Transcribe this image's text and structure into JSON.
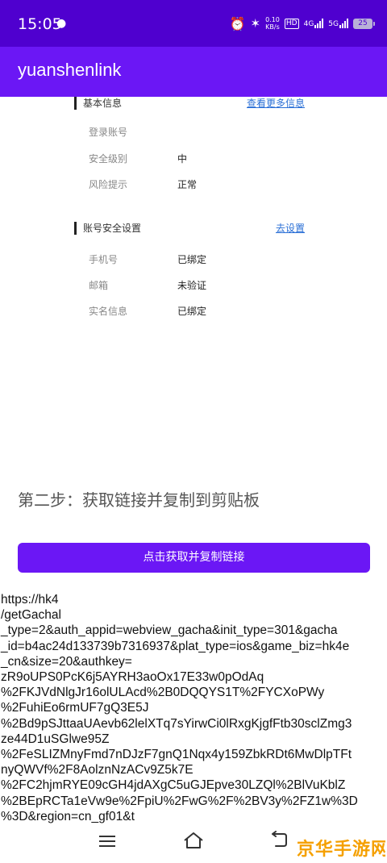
{
  "status_bar": {
    "time": "15:05",
    "speed_top": "0.10",
    "speed_bottom": "KB/s",
    "hd_label": "HD",
    "net1": "4G",
    "net2": "5G",
    "battery": "25"
  },
  "app_bar": {
    "title": "yuanshenlink"
  },
  "basic_info": {
    "title": "基本信息",
    "link": "查看更多信息",
    "rows": [
      {
        "label": "登录账号",
        "value": ""
      },
      {
        "label": "安全级别",
        "value": "中"
      },
      {
        "label": "风险提示",
        "value": "正常"
      }
    ]
  },
  "account_security": {
    "title": "账号安全设置",
    "link": "去设置",
    "rows": [
      {
        "label": "手机号",
        "value": "已绑定"
      },
      {
        "label": "邮箱",
        "value": "未验证"
      },
      {
        "label": "实名信息",
        "value": "已绑定"
      }
    ]
  },
  "step2": {
    "title": "第二步：获取链接并复制到剪贴板",
    "button_label": "点击获取并复制链接"
  },
  "result_link": "https://hk4\n/getGachal\n_type=2&auth_appid=webview_gacha&init_type=301&gacha\n_id=b4ac24d133739b7316937&plat_type=ios&game_biz=hk4e\n_cn&size=20&authkey=\nzR9oUPS0PcK6j5AYRH3aoOx17E33w0pOdAq\n%2FKJVdNlgJr16olULAcd%2B0DQQYS1T%2FYCXoPWy\n%2FuhiEo6rmUF7gQ3E5J\n%2Bd9pSJttaaUAevb62lelXTq7sYirwCi0lRxgKjgfFtb30sclZmg3\nze44D1uSGlwe95Z\n%2FeSLIZMnyFmd7nDJzF7gnQ1Nqx4y159ZbkRDt6MwDlpTFt\nnyQWVf%2F8AolznNzACv9Z5k7E\n%2FC2hjmRYE09cGH4jdAXgC5uGJEpve30LZQl%2BlVuKblZ\n%2BEpRCTa1eVw9e%2FpiU%2FwG%2F%2BV3y%2FZ1w%3D\n%3D&region=cn_gf01&t",
  "watermark": "京华手游网"
}
